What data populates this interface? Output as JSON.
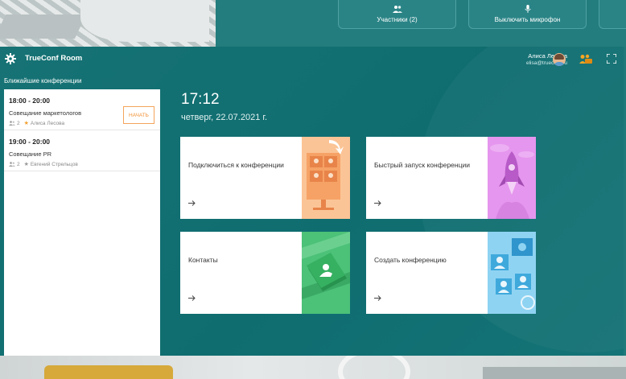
{
  "background": {
    "controls": [
      {
        "label": "Участники (2)",
        "icon": "people-icon"
      },
      {
        "label": "Выключить микрофон",
        "icon": "microphone-icon"
      }
    ]
  },
  "header": {
    "app_title": "TrueConf Room",
    "user_name": "Алиса Лесова",
    "user_email": "elisa@trueconf.ru",
    "icons": [
      "gear-icon",
      "avatar",
      "camera-people-icon",
      "fullscreen-icon"
    ]
  },
  "sidebar": {
    "heading": "Ближайшие конференции",
    "conferences": [
      {
        "time": "18:00 - 20:00",
        "name": "Совещание маркетологов",
        "participants": "2",
        "owner": "Алиса Лесова",
        "start_label": "НАЧАТЬ"
      },
      {
        "time": "19:00 - 20:00",
        "name": "Совещание PR",
        "participants": "2",
        "owner": "Евгений Стрельцов"
      }
    ]
  },
  "main": {
    "time": "17:12",
    "date": "четверг, 22.07.2021 г.",
    "tiles": {
      "connect": "Подключиться к конференции",
      "quick": "Быстрый запуск конференции",
      "contacts": "Контакты",
      "create": "Создать конференцию"
    }
  },
  "colors": {
    "accent": "#1f7a7c",
    "orange": "#f29237",
    "tile_connect": "#f9b77f",
    "tile_quick": "#d57be0",
    "tile_contacts": "#3fb86a",
    "tile_create": "#5cbbe6"
  }
}
